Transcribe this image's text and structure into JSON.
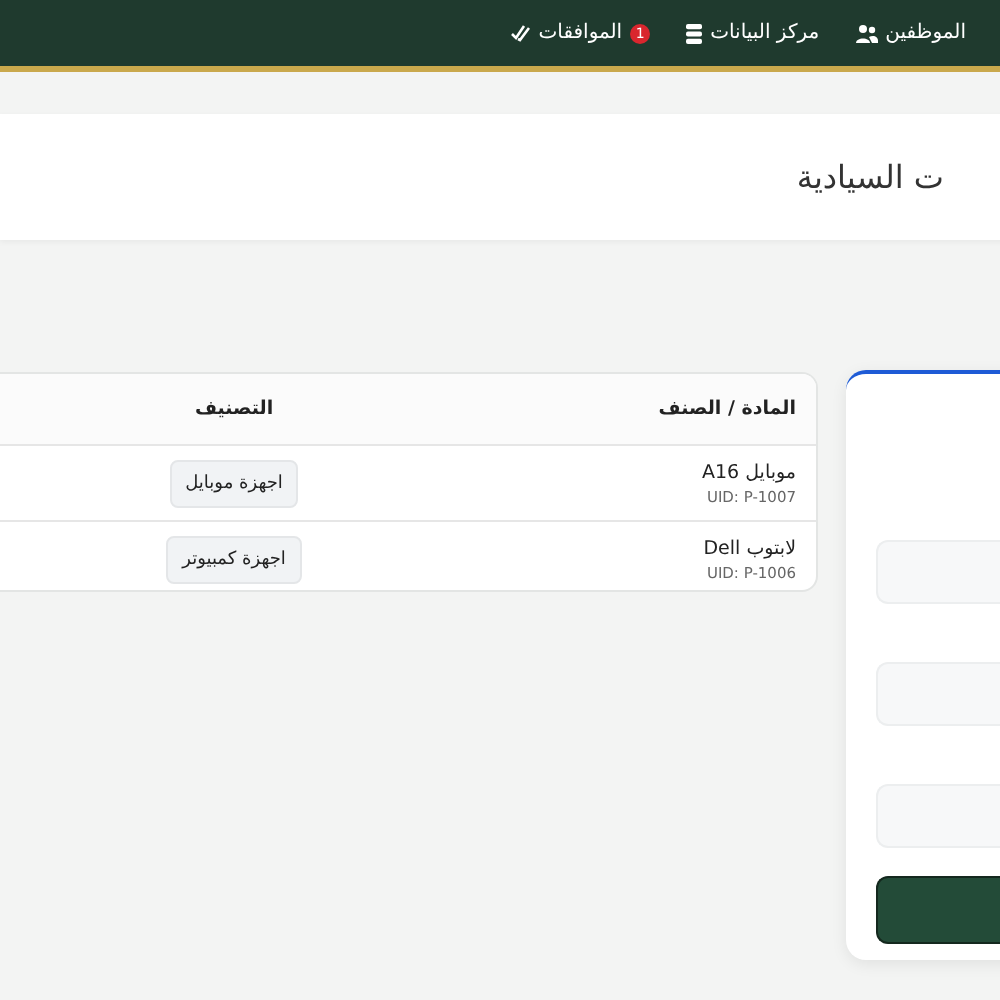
{
  "nav": {
    "items": [
      {
        "label": "الموظفين"
      },
      {
        "label": "مركز البيانات"
      },
      {
        "label": "الموافقات",
        "badge": "1"
      }
    ]
  },
  "page_title": "ت السيادية",
  "table": {
    "columns": [
      "المادة / الصنف",
      "التصنيف"
    ],
    "rows": [
      {
        "name": "موبايل A16",
        "uid": "UID: P-1007",
        "category": "اجهزة موبايل"
      },
      {
        "name": "لابتوب Dell",
        "uid": "UID: P-1006",
        "category": "اجهزة كمبيوتر"
      }
    ]
  }
}
